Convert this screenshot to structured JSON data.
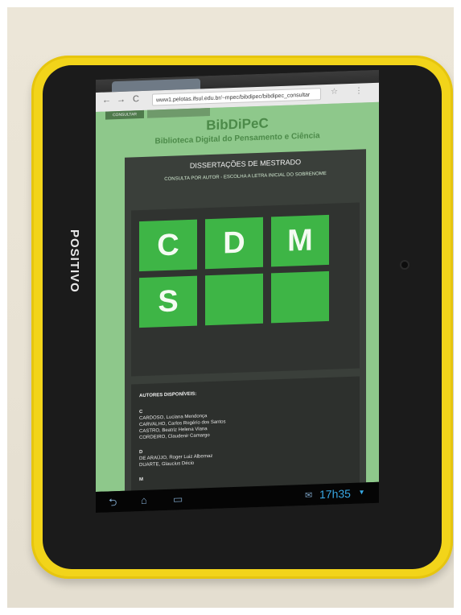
{
  "device": {
    "brand": "POSITIVO"
  },
  "browser": {
    "tab_title": "",
    "url": "www1.pelotas.ifsul.edu.br/~mpec/bibdipec/bibdipec_consultar",
    "nav_back": "←",
    "nav_forward": "→",
    "nav_reload": "C",
    "star": "☆",
    "menu": "⋮"
  },
  "page": {
    "tabs": [
      "CONSULTAR",
      ""
    ],
    "title": "BibDiPeC",
    "subtitle": "Biblioteca Digital do Pensamento e Ciência",
    "heading": "DISSERTAÇÕES DE MESTRADO",
    "subheading": "CONSULTA POR AUTOR - ESCOLHA A LETRA INICIAL DO SOBRENOME",
    "updated": "",
    "letter_tiles": [
      "C",
      "D",
      "M",
      "S",
      "",
      ""
    ],
    "authors_title": "AUTORES DISPONÍVEIS:",
    "authors": {
      "c_letter": "C",
      "c_names": [
        "CARDOSO, Luciana Mendonça",
        "CARVALHO, Carlos Rogério dos Santos",
        "CASTRO, Beatriz Helena Viana",
        "CORDEIRO, Claudenir Camargo"
      ],
      "d_letter": "D",
      "d_names": [
        "DE ARAÚJO, Roger Luiz Albernaz",
        "DUARTE, Glaucius Décio"
      ],
      "m_letter": "M"
    }
  },
  "system_bar": {
    "back_icon": "⮌",
    "home_icon": "⌂",
    "recents_icon": "▭",
    "mail_icon": "✉",
    "time": "17h35"
  },
  "colors": {
    "yellow_case": "#f2d41a",
    "tile_green": "#3eb546",
    "page_green": "#8ec88b",
    "clock_blue": "#38a9e6"
  }
}
